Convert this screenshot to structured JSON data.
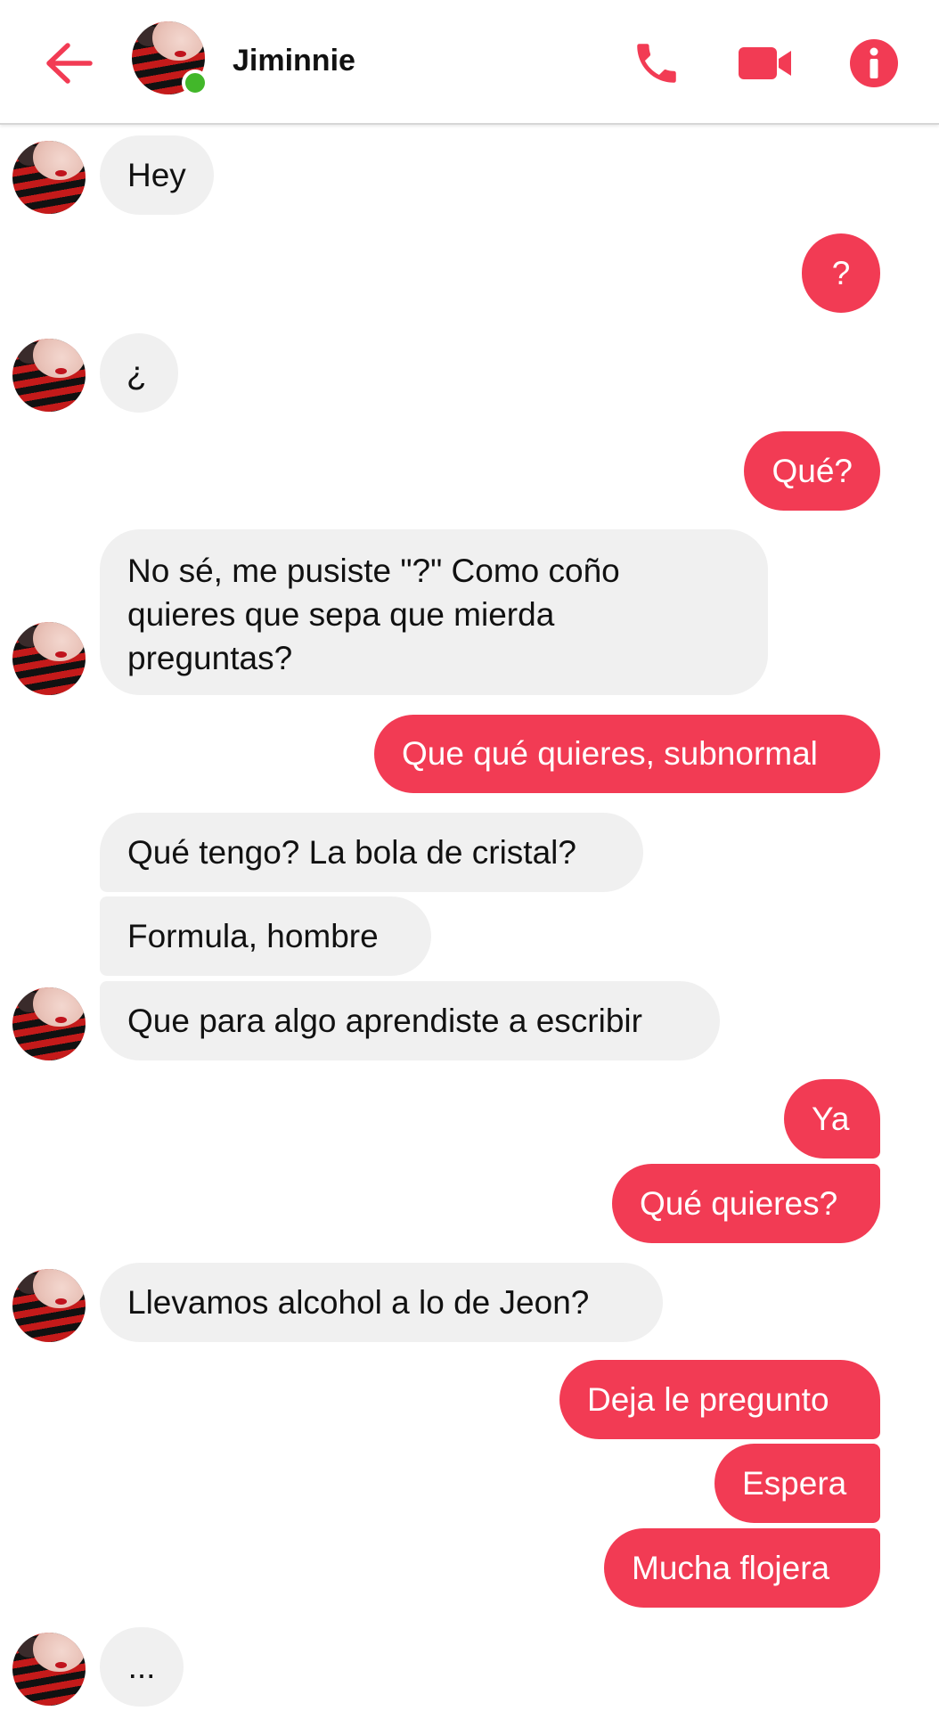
{
  "header": {
    "contact_name": "Jiminnie",
    "online": true,
    "icons": [
      "back-arrow-icon",
      "phone-icon",
      "video-camera-icon",
      "info-icon"
    ],
    "accent_color": "#f23b54"
  },
  "messages": [
    {
      "from": "contact",
      "text": "Hey"
    },
    {
      "from": "me",
      "text": "?"
    },
    {
      "from": "contact",
      "text": "¿"
    },
    {
      "from": "me",
      "text": "Qué?"
    },
    {
      "from": "contact",
      "lines": [
        "No sé, me pusiste \"?\" Como coño",
        "quieres que sepa que mierda",
        "preguntas?"
      ]
    },
    {
      "from": "me",
      "text": "Que qué quieres, subnormal"
    },
    {
      "from": "contact",
      "text": "Qué tengo? La bola de cristal?"
    },
    {
      "from": "contact",
      "text": "Formula, hombre"
    },
    {
      "from": "contact",
      "text": "Que para algo aprendiste a escribir"
    },
    {
      "from": "me",
      "text": "Ya"
    },
    {
      "from": "me",
      "text": "Qué quieres?"
    },
    {
      "from": "contact",
      "text": "Llevamos alcohol a lo de Jeon?"
    },
    {
      "from": "me",
      "text": "Deja le pregunto"
    },
    {
      "from": "me",
      "text": "Espera"
    },
    {
      "from": "me",
      "text": "Mucha flojera"
    },
    {
      "from": "contact",
      "text": "..."
    }
  ]
}
